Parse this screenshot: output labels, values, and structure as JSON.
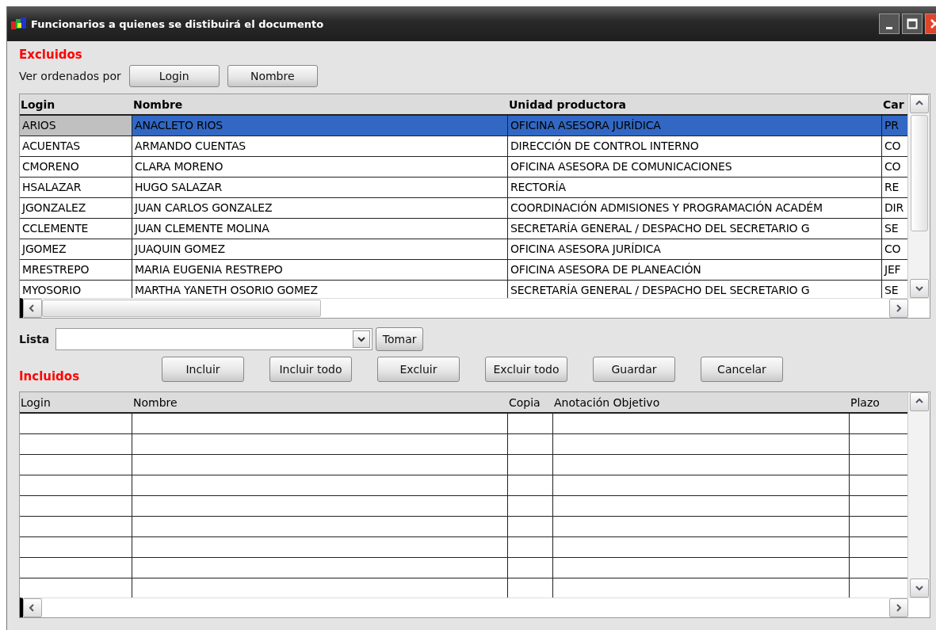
{
  "window": {
    "title": "Funcionarios a quienes se distibuirá el documento"
  },
  "excluded": {
    "heading": "Excluidos",
    "sort_label": "Ver ordenados por",
    "sort_buttons": [
      "Login",
      "Nombre"
    ],
    "columns": [
      "Login",
      "Nombre",
      "Unidad productora",
      "Car"
    ],
    "rows": [
      {
        "cells": [
          "ARIOS",
          "ANACLETO RIOS",
          "OFICINA ASESORA JURÍDICA",
          "PR"
        ],
        "selected": true
      },
      {
        "cells": [
          "ACUENTAS",
          "ARMANDO CUENTAS",
          "DIRECCIÓN DE CONTROL INTERNO",
          "CO"
        ],
        "selected": false
      },
      {
        "cells": [
          "CMORENO",
          "CLARA MORENO",
          "OFICINA ASESORA DE COMUNICACIONES",
          "CO"
        ],
        "selected": false
      },
      {
        "cells": [
          "HSALAZAR",
          "HUGO SALAZAR",
          "RECTORÍA",
          "RE"
        ],
        "selected": false
      },
      {
        "cells": [
          "JGONZALEZ",
          "JUAN CARLOS GONZALEZ",
          "COORDINACIÓN ADMISIONES Y PROGRAMACIÓN ACADÉM",
          "DIR"
        ],
        "selected": false
      },
      {
        "cells": [
          "CCLEMENTE",
          "JUAN CLEMENTE MOLINA",
          "SECRETARÍA GENERAL / DESPACHO DEL SECRETARIO G",
          "SE"
        ],
        "selected": false
      },
      {
        "cells": [
          "JGOMEZ",
          "JUAQUIN GOMEZ",
          "OFICINA ASESORA JURÍDICA",
          "CO"
        ],
        "selected": false
      },
      {
        "cells": [
          "MRESTREPO",
          "MARIA EUGENIA RESTREPO",
          "OFICINA ASESORA DE PLANEACIÓN",
          "JEF"
        ],
        "selected": false
      },
      {
        "cells": [
          "MYOSORIO",
          "MARTHA YANETH OSORIO GOMEZ",
          "SECRETARÍA GENERAL / DESPACHO DEL SECRETARIO G",
          "SE"
        ],
        "selected": false
      }
    ]
  },
  "list": {
    "label": "Lista",
    "take_button": "Tomar"
  },
  "actions": [
    "Incluir",
    "Incluir todo",
    "Excluir",
    "Excluir todo",
    "Guardar",
    "Cancelar"
  ],
  "included": {
    "heading": "Incluidos",
    "columns": [
      "Login",
      "Nombre",
      "Copia",
      "Anotación Objetivo",
      "Plazo"
    ]
  }
}
